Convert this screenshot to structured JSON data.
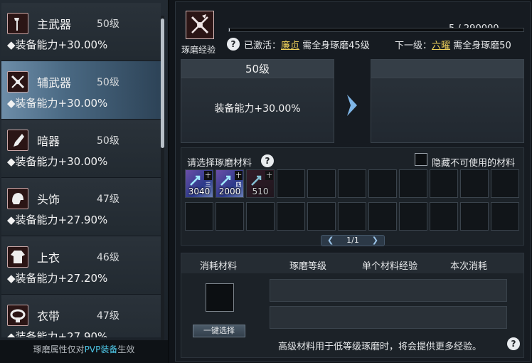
{
  "equipment": [
    {
      "name": "主武器",
      "level": "50级",
      "stat": "◆装备能力+30.00%",
      "icon": "hammer-icon",
      "selected": false
    },
    {
      "name": "辅武器",
      "level": "50级",
      "stat": "◆装备能力+30.00%",
      "icon": "crossed-blades-icon",
      "selected": true
    },
    {
      "name": "暗器",
      "level": "50级",
      "stat": "◆装备能力+30.00%",
      "icon": "dart-icon",
      "selected": false
    },
    {
      "name": "头饰",
      "level": "47级",
      "stat": "◆装备能力+27.90%",
      "icon": "helmet-icon",
      "selected": false
    },
    {
      "name": "上衣",
      "level": "46级",
      "stat": "◆装备能力+27.20%",
      "icon": "robe-icon",
      "selected": false
    },
    {
      "name": "衣带",
      "level": "47级",
      "stat": "◆装备能力+27.90%",
      "icon": "belt-icon",
      "selected": false
    }
  ],
  "footer": {
    "prefix": "琢磨属性仅对",
    "pvp": "PVP装备",
    "suffix": "生效"
  },
  "polish": {
    "label": "琢磨经验",
    "progress_text": "5 / 290000",
    "progress_fraction": 1.7e-05,
    "activated_label": "已激活：",
    "activated_name": "廉贞",
    "activated_req": "需全身琢磨45级",
    "next_label": "下一级：",
    "next_name": "六曜",
    "next_req": "需全身琢磨50",
    "help": "?"
  },
  "current": {
    "level": "50级",
    "stat": "装备能力+30.00%"
  },
  "materials": {
    "title": "请选择琢磨材料",
    "hide_label": "隐藏不可使用的材料",
    "help": "?",
    "items": [
      {
        "count": "3040",
        "tag": "十三",
        "usable": true
      },
      {
        "count": "2000",
        "tag": "十四",
        "usable": true
      },
      {
        "count": "510",
        "tag": "十",
        "usable": false
      }
    ],
    "page": "1/1"
  },
  "consume": {
    "headers": [
      "消耗材料",
      "琢磨等级",
      "单个材料经验",
      "本次消耗"
    ],
    "auto_button": "一键选择",
    "note": "高级材料用于低等级琢磨时，将会提供更多经验。",
    "help": "?"
  },
  "colors": {
    "accent_gold": "#f0d25a",
    "pvp_cyan": "#4ec8e8",
    "selected_row": "#4a6983"
  }
}
